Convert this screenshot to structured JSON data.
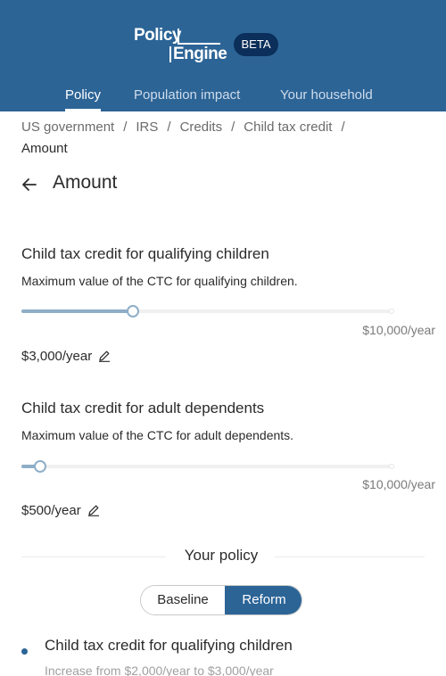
{
  "header": {
    "logo_top": "Policy",
    "logo_bottom": "Engine",
    "badge": "BETA",
    "tabs": [
      {
        "label": "Policy"
      },
      {
        "label": "Population impact"
      },
      {
        "label": "Your household"
      }
    ]
  },
  "breadcrumb": {
    "items": [
      "US government",
      "IRS",
      "Credits",
      "Child tax credit"
    ],
    "separator": "/",
    "current": "Amount"
  },
  "page": {
    "title": "Amount"
  },
  "parameters": [
    {
      "title": "Child tax credit for qualifying children",
      "description": "Maximum value of the CTC for qualifying children.",
      "max_label": "$10,000/year",
      "value_label": "$3,000/year",
      "slider_fraction": 0.3
    },
    {
      "title": "Child tax credit for adult dependents",
      "description": "Maximum value of the CTC for adult dependents.",
      "max_label": "$10,000/year",
      "value_label": "$500/year",
      "slider_fraction": 0.05
    }
  ],
  "policy_summary": {
    "heading": "Your policy",
    "toggle": {
      "baseline": "Baseline",
      "reform": "Reform",
      "selected": "Reform"
    },
    "changes": [
      {
        "title": "Child tax credit for qualifying children",
        "description": "Increase from $2,000/year to $3,000/year"
      }
    ]
  },
  "colors": {
    "brand": "#2c6496",
    "badge": "#0b2f5a",
    "slider": "#8eaec8"
  },
  "icons": {
    "back": "arrow-left-icon",
    "edit": "pencil-icon"
  }
}
